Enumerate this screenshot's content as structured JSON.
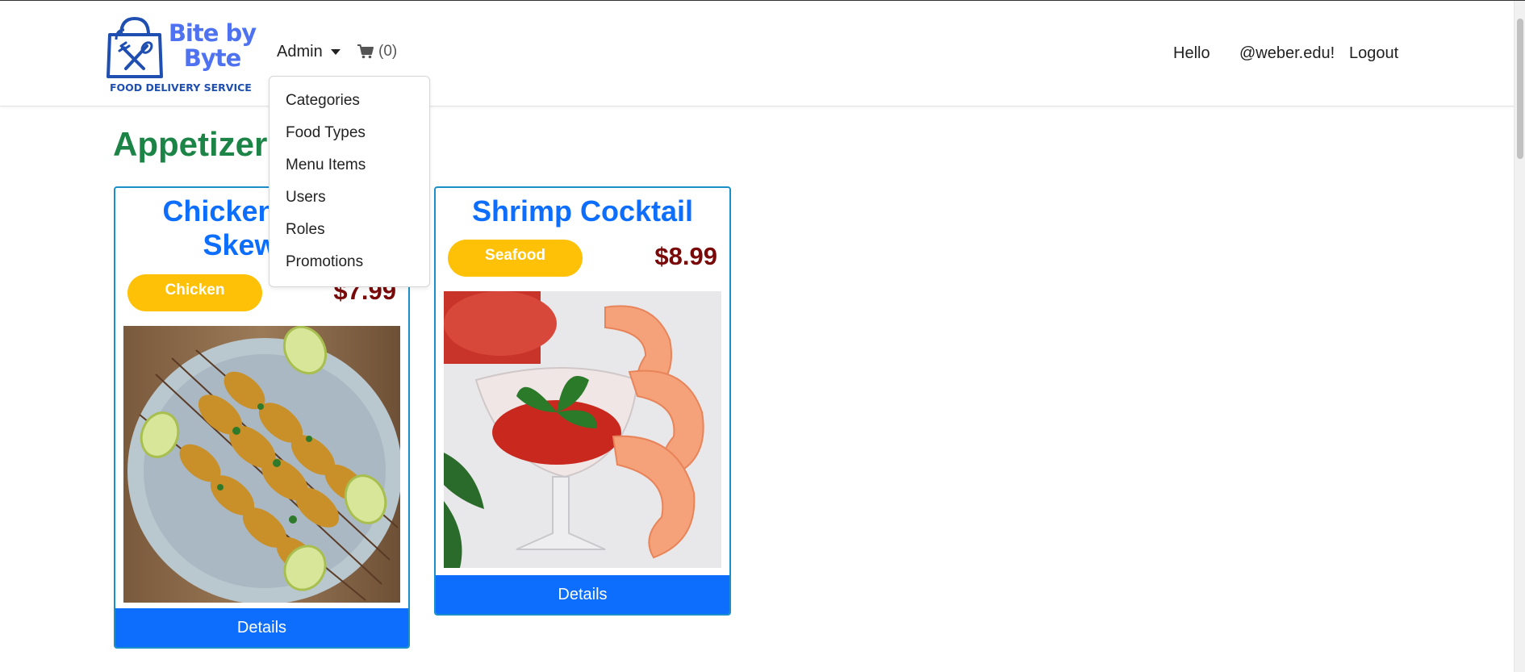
{
  "brand": {
    "name_line1": "Bite by",
    "name_line2": "Byte",
    "tagline": "FOOD DELIVERY SERVICE",
    "color": "#4f72f0"
  },
  "nav": {
    "admin_label": "Admin",
    "cart_count": "(0)",
    "hello_label": "Hello",
    "user_email": "@weber.edu!",
    "logout_label": "Logout"
  },
  "admin_menu": {
    "items": [
      {
        "label": "Categories"
      },
      {
        "label": "Food Types"
      },
      {
        "label": "Menu Items"
      },
      {
        "label": "Users"
      },
      {
        "label": "Roles"
      },
      {
        "label": "Promotions"
      }
    ]
  },
  "page": {
    "title": "Appetizers"
  },
  "cards": [
    {
      "title": "Chicken Satay Skewers",
      "badge": "Chicken",
      "price": "$7.99",
      "image": "chicken-skewers-photo",
      "button": "Details"
    },
    {
      "title": "Shrimp Cocktail",
      "badge": "Seafood",
      "price": "$8.99",
      "image": "shrimp-cocktail-photo",
      "button": "Details"
    }
  ],
  "colors": {
    "title_green": "#1d8447",
    "card_title_blue": "#0d6efd",
    "badge_yellow": "#ffc107",
    "price_red": "#7a0a0a",
    "button_blue": "#0d6efd"
  }
}
